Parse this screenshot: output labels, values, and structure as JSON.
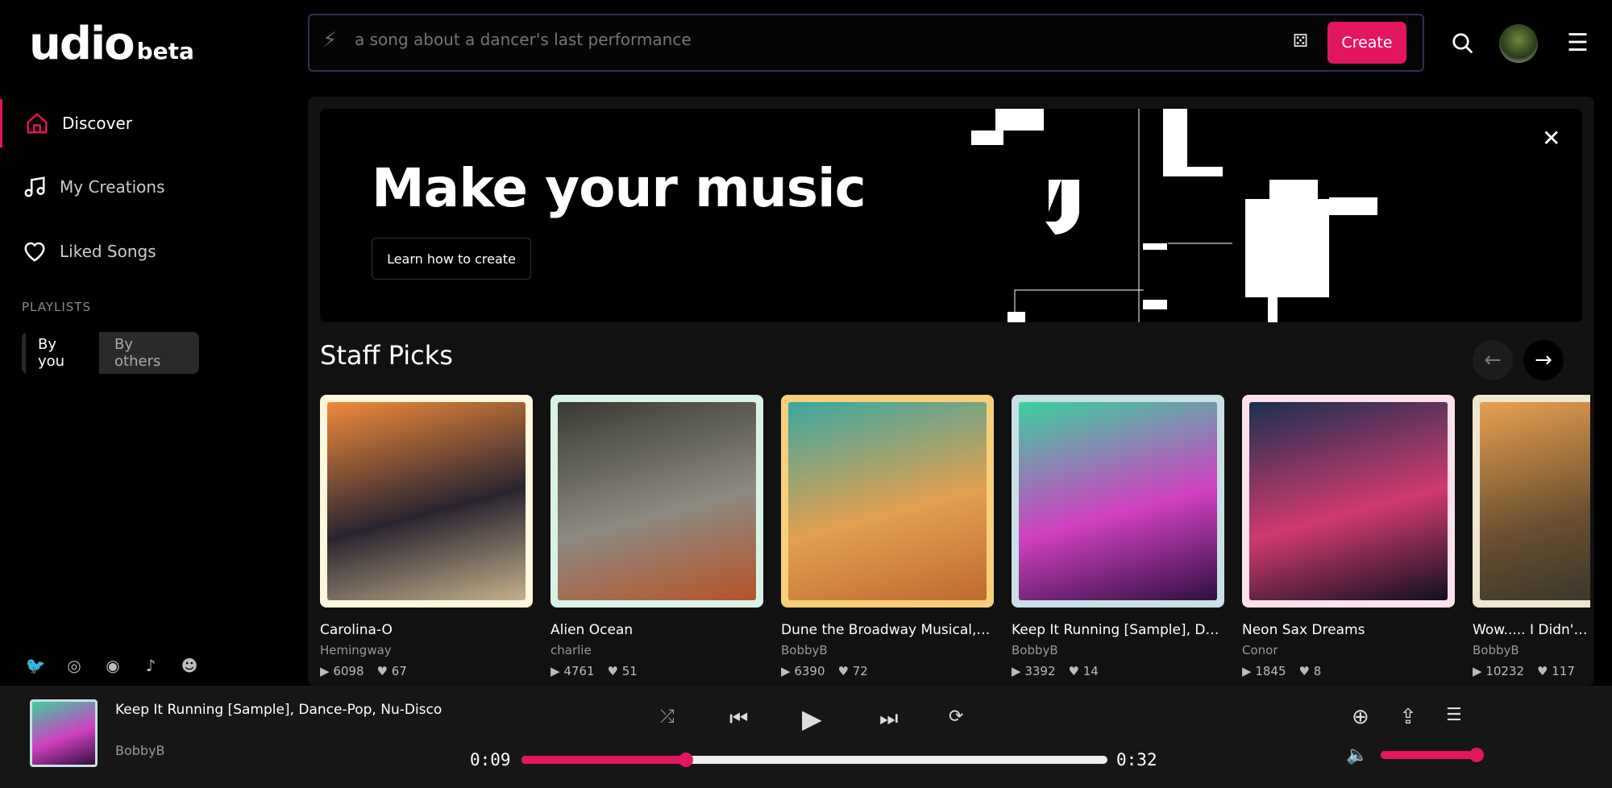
{
  "logo": {
    "name": "udio",
    "tag": "beta"
  },
  "sidebar": {
    "items": [
      {
        "label": "Discover",
        "icon": "home-icon"
      },
      {
        "label": "My Creations",
        "icon": "music-note-icon"
      },
      {
        "label": "Liked Songs",
        "icon": "heart-icon"
      }
    ],
    "playlists_label": "PLAYLISTS",
    "toggle": [
      "By you",
      "By others"
    ],
    "social": [
      "twitter-icon",
      "instagram-icon",
      "discord-icon",
      "tiktok-icon",
      "reddit-icon"
    ]
  },
  "search": {
    "placeholder": "a song about a dancer's last performance",
    "create_label": "Create"
  },
  "banner": {
    "title": "Make your music",
    "button": "Learn how to create"
  },
  "staff_picks": {
    "title": "Staff Picks",
    "cards": [
      {
        "title": "Carolina-O",
        "artist": "Hemingway",
        "plays": "6098",
        "likes": "67",
        "frame": "#fdf7dc",
        "art": [
          "#f08a3a",
          "#2a2430",
          "#c4b08a"
        ]
      },
      {
        "title": "Alien Ocean",
        "artist": "charlie",
        "plays": "4761",
        "likes": "51",
        "frame": "#d9f2e6",
        "art": [
          "#3a3a34",
          "#8c8a80",
          "#b8542a"
        ]
      },
      {
        "title": "Dune the Broadway Musical, Sh...",
        "artist": "BobbyB",
        "plays": "6390",
        "likes": "72",
        "frame": "#f6cf7a",
        "art": [
          "#3aa7a0",
          "#e2a050",
          "#c06a30"
        ]
      },
      {
        "title": "Keep It Running [Sample], Danc...",
        "artist": "BobbyB",
        "plays": "3392",
        "likes": "14",
        "frame": "#c8dfe6",
        "art": [
          "#3ad0a0",
          "#d040c0",
          "#301040"
        ]
      },
      {
        "title": "Neon Sax Dreams",
        "artist": "Conor",
        "plays": "1845",
        "likes": "8",
        "frame": "#fde0ec",
        "art": [
          "#1a3050",
          "#d03a70",
          "#101020"
        ]
      },
      {
        "title": "Wow..... I Didn't K",
        "artist": "BobbyB",
        "plays": "10232",
        "likes": "117",
        "frame": "#efe6cf",
        "art": [
          "#e8a050",
          "#6a5030",
          "#30302a"
        ]
      }
    ]
  },
  "player": {
    "title": "Keep It Running [Sample], Dance-Pop, Nu-Disco",
    "artist": "BobbyB",
    "elapsed": "0:09",
    "duration": "0:32",
    "progress": 0.28,
    "volume": 1.0
  },
  "colors": {
    "accent": "#e2165e"
  }
}
